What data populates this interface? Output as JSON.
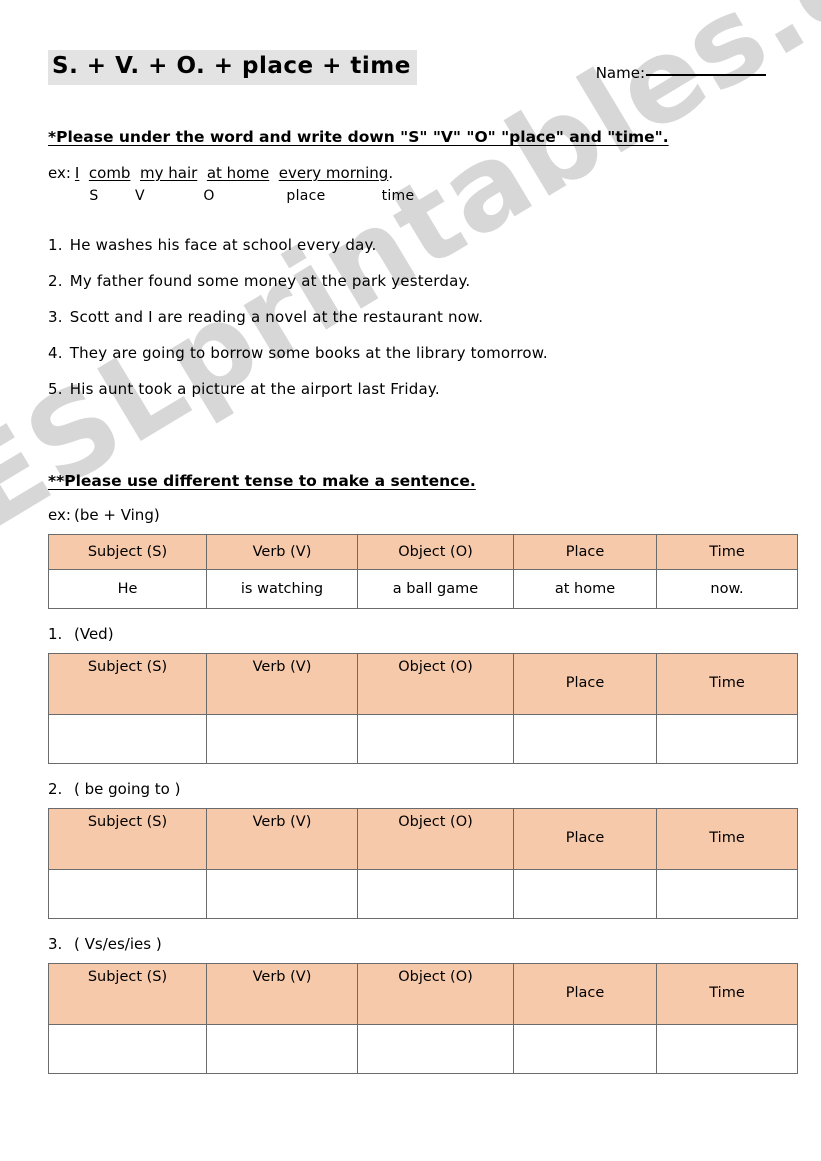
{
  "document": {
    "title": "S. + V. + O. + place + time",
    "name_label": "Name:",
    "watermark": "ESLprintables.com",
    "highlight_color": "#e3e3e3",
    "table_header_color": "#f7c9ab",
    "table_border_color": "#6b6b6b"
  },
  "section1": {
    "instruction": "*Please under the word and write down \"S\" \"V\" \"O\" \"place\" and \"time\".",
    "example": {
      "label": "ex:",
      "parts": [
        {
          "text": "I",
          "tag": "S"
        },
        {
          "text": "comb",
          "tag": "V"
        },
        {
          "text": "my hair",
          "tag": "O"
        },
        {
          "text": "at home",
          "tag": "place"
        },
        {
          "text": "every morning",
          "tag": "time"
        }
      ],
      "period": ".",
      "tags": [
        "S",
        "V",
        "O",
        "place",
        "time"
      ]
    },
    "sentences": [
      {
        "num": "1.",
        "text": "He  washes  his  face  at  school  every  day."
      },
      {
        "num": "2.",
        "text": "My  father  found  some  money  at  the  park  yesterday."
      },
      {
        "num": "3.",
        "text": "Scott  and  I   are  reading   a  novel  at  the  restaurant  now."
      },
      {
        "num": "4.",
        "text": "They  are  going  to  borrow  some  books  at  the library  tomorrow."
      },
      {
        "num": "5.",
        "text": "His  aunt  took  a  picture  at  the  airport  last  Friday."
      }
    ]
  },
  "section2": {
    "instruction": "**Please use different tense to make a sentence.",
    "columns": [
      "Subject (S)",
      "Verb (V)",
      "Object (O)",
      "Place",
      "Time"
    ],
    "example_table": {
      "num": "ex:",
      "tense": "(be + Ving)",
      "row": [
        "He",
        "is watching",
        "a ball game",
        "at home",
        "now."
      ]
    },
    "blank_tables": [
      {
        "num": "1.",
        "tense": "(Ved)",
        "row": [
          "",
          "",
          "",
          "",
          ""
        ]
      },
      {
        "num": "2.",
        "tense": "( be going to )",
        "row": [
          "",
          "",
          "",
          "",
          ""
        ]
      },
      {
        "num": "3.",
        "tense": "( Vs/es/ies )",
        "row": [
          "",
          "",
          "",
          "",
          ""
        ]
      }
    ]
  }
}
